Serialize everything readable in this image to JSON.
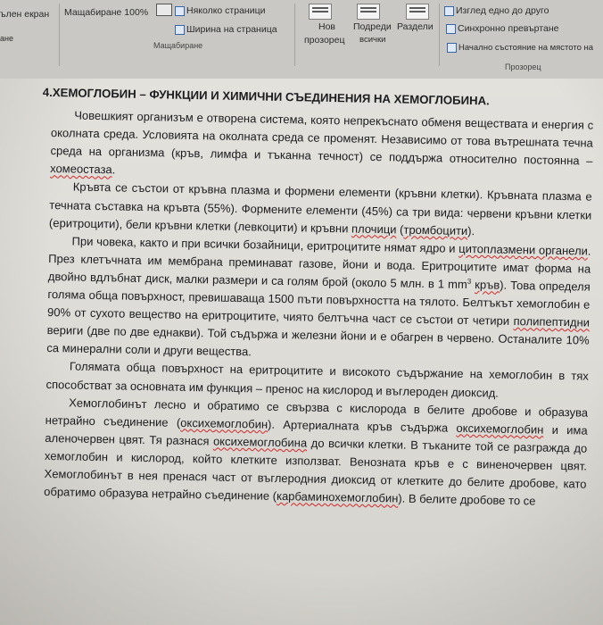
{
  "ribbon": {
    "full_screen": "ълен екран",
    "reading": "ане",
    "zoom_100": "Мащабиране 100%",
    "multi_pages": "Няколко страници",
    "page_width": "Ширина на страница",
    "zoom_group": "Мащабиране",
    "new_window_1": "Нов",
    "new_window_2": "прозорец",
    "arrange_1": "Подреди",
    "arrange_2": "всички",
    "split": "Раздели",
    "side_by_side": "Изглед едно до друго",
    "sync_scroll": "Синхронно превъртане",
    "reset_position": "Начално състояние на мястото на",
    "window_group": "Прозорец"
  },
  "document": {
    "heading": "4.ХЕМОГЛОБИН – ФУНКЦИИ И ХИМИЧНИ СЪЕДИНЕНИЯ НА ХЕМОГЛОБИНА.",
    "p1": {
      "t1": "Човешкият организъм е отворена система, която непрекъснато обменя веществата и енергия с околната среда. Условията на околната среда се променят. Независимо от това вътрешната течна среда на организма (кръв, лимфа и тъканна течност) се поддържа относително постоянна – ",
      "w1": "хомеостаза",
      "t2": "."
    },
    "p2": {
      "t1": "Кръвта се състои от кръвна плазма и формени елементи (кръвни клетки). Кръвната плазма е течната съставка на кръвта (55%). Формените елементи (45%) са три вида: червени кръвни клетки (еритроцити), бели кръвни клетки (левкоцити) и кръвни ",
      "w1": "плочици",
      "t2": " (",
      "w2": "тромбоцити",
      "t3": ")."
    },
    "p3": {
      "t1": "При човека, както и при всички бозайници, еритроцитите нямат ядро и ",
      "w1": "цитоплазмени органели",
      "t2": ". През клетъчната им мембрана преминават газове, йони и вода. Еритроцитите имат форма на двойно вдлъбнат диск, малки размери и са голям брой (около 5 млн. в 1 mm",
      "sup": "3",
      "t3": " ",
      "w2": "кръв",
      "t4": "). Това определя голяма обща повърхност, превишаваща 1500 пъти повърхността на тялото. Белтъкът хемоглобин е 90% от сухото вещество на еритроцитите, чиято белтъчна част се състои от четири ",
      "w3": "полипептидни",
      "t5": " вериги (две по две еднакви). Той съдържа и железни йони и е обагрен в червено. Останалите 10% са минерални соли и други вещества."
    },
    "p4": {
      "t1": "Голямата обща повърхност на еритроцитите и високото съдържание на хемоглобин в тях способстват за основната им функция – пренос на кислород и въглероден диоксид."
    },
    "p5": {
      "t1": "Хемоглобинът лесно и обратимо се свързва с кислорода в белите дробове и образува нетрайно съединение (",
      "w1": "оксихемоглобин",
      "t2": "). Артериалната кръв съдържа ",
      "w2": "оксихемоглобин",
      "t3": " и има аленочервен цвят. Тя разнася ",
      "w3": "оксихемоглобина",
      "t4": " до всички клетки. В тъканите той се разгражда до хемоглобин и кислород, който клетките използват. Венозната кръв е с виненочервен цвят. Хемоглобинът в нея пренася част от въглеродния диоксид от клетките до белите дробове, като обратимо образува нетрайно съединение (",
      "w4": "карбаминохемоглобин",
      "t5": "). В белите дробове то се"
    }
  }
}
